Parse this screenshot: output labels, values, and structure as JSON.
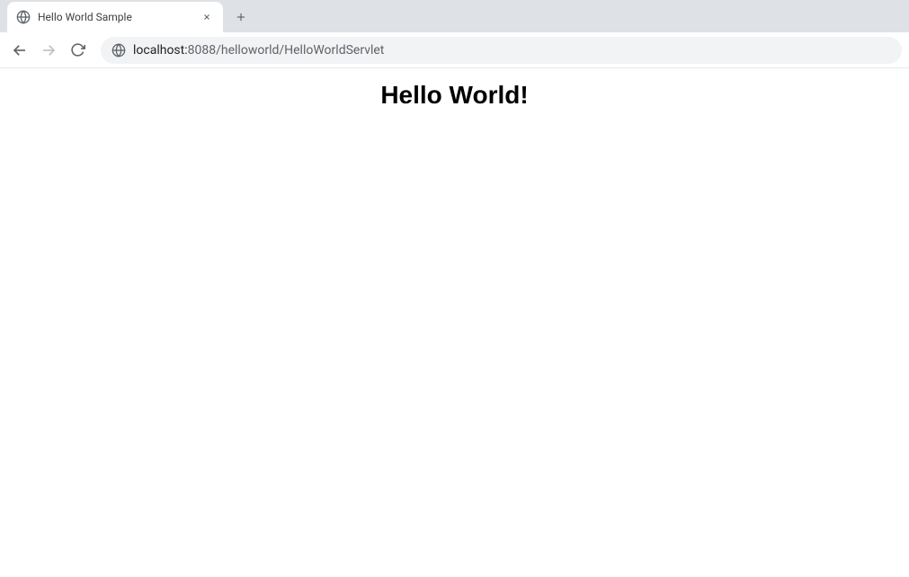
{
  "browser": {
    "tab": {
      "title": "Hello World Sample"
    },
    "address": {
      "host": "localhost:",
      "path": "8088/helloworld/HelloWorldServlet"
    }
  },
  "page": {
    "heading": "Hello World!"
  }
}
